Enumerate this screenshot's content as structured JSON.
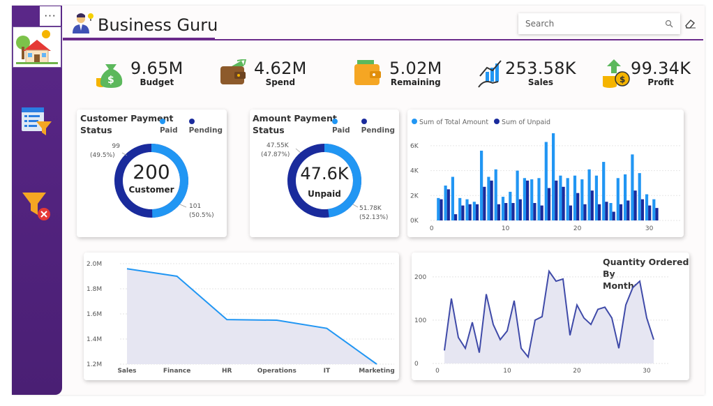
{
  "app": {
    "title": "Business Guru"
  },
  "search": {
    "placeholder": "Search"
  },
  "menu": {
    "dots": "···"
  },
  "kpis": [
    {
      "value": "9.65M",
      "label": "Budget"
    },
    {
      "value": "4.62M",
      "label": "Spend"
    },
    {
      "value": "5.02M",
      "label": "Remaining"
    },
    {
      "value": "253.58K",
      "label": "Sales"
    },
    {
      "value": "99.34K",
      "label": "Profit"
    }
  ],
  "donut_customer": {
    "title_line1": "Customer Payment",
    "title_line2": "Status",
    "legend": [
      "Paid",
      "Pending"
    ],
    "center_value": "200",
    "center_label": "Customer",
    "paid_label_1": "99",
    "paid_label_2": "(49.5%)",
    "pending_label_1": "101",
    "pending_label_2": "(50.5%)",
    "paid_fraction": 0.495
  },
  "donut_amount": {
    "title_line1": "Amount Payment",
    "title_line2": "Status",
    "legend": [
      "Paid",
      "Pending"
    ],
    "center_value": "47.6K",
    "center_label": "Unpaid",
    "paid_label_1": "47.55K",
    "paid_label_2": "(47.87%)",
    "pending_label_1": "51.78K",
    "pending_label_2": "(52.13%)",
    "paid_fraction": 0.4787
  },
  "colors": {
    "paid": "#2196f3",
    "pending": "#1a2b9c",
    "purple": "#5a2788",
    "line": "#2196f3",
    "area": "#e6e6f2",
    "qty": "#3f4aa8"
  },
  "chart_data": [
    {
      "type": "bar",
      "legend": [
        "Sum of Total Amount",
        "Sum of Unpaid"
      ],
      "x": [
        1,
        2,
        3,
        4,
        5,
        6,
        7,
        8,
        9,
        10,
        11,
        12,
        13,
        14,
        15,
        16,
        17,
        18,
        19,
        20,
        21,
        22,
        23,
        24,
        25,
        26,
        27,
        28,
        29,
        30,
        31
      ],
      "series": [
        {
          "name": "Sum of Total Amount",
          "values": [
            1800,
            2800,
            3500,
            1800,
            1700,
            1500,
            5600,
            3500,
            4100,
            1900,
            2300,
            4000,
            3400,
            3300,
            3400,
            6300,
            7000,
            3600,
            3400,
            3600,
            3300,
            4100,
            3600,
            4700,
            1400,
            3400,
            3700,
            5300,
            3800,
            2100,
            1700
          ]
        },
        {
          "name": "Sum of Unpaid",
          "values": [
            1700,
            2500,
            500,
            1200,
            1300,
            1300,
            2700,
            3200,
            1300,
            1400,
            1400,
            1700,
            3200,
            1400,
            1200,
            2600,
            3200,
            2700,
            1200,
            2200,
            1300,
            2400,
            1300,
            1500,
            700,
            1300,
            1600,
            2400,
            1700,
            1200,
            1000
          ]
        }
      ],
      "yticks": [
        "0K",
        "2K",
        "4K",
        "6K"
      ],
      "xticks": [
        "0",
        "10",
        "20",
        "30"
      ],
      "ylim": [
        0,
        7000
      ]
    },
    {
      "type": "area",
      "categories": [
        "Sales",
        "Finance",
        "HR",
        "Operations",
        "IT",
        "Marketing"
      ],
      "values": [
        1960000,
        1900000,
        1555000,
        1550000,
        1485000,
        1200000
      ],
      "yticks": [
        "1.2M",
        "1.4M",
        "1.6M",
        "1.8M",
        "2.0M"
      ],
      "ylim": [
        1200000,
        2000000
      ]
    },
    {
      "type": "area",
      "title_line1": "Quantity Ordered By",
      "title_line2": "Months",
      "x": [
        1,
        2,
        3,
        4,
        5,
        6,
        7,
        8,
        9,
        10,
        11,
        12,
        13,
        14,
        15,
        16,
        17,
        18,
        19,
        20,
        21,
        22,
        23,
        24,
        25,
        26,
        27,
        28,
        29,
        30,
        31
      ],
      "values": [
        30,
        150,
        60,
        35,
        95,
        25,
        160,
        90,
        55,
        75,
        145,
        35,
        15,
        100,
        108,
        213,
        190,
        195,
        65,
        135,
        105,
        90,
        125,
        130,
        105,
        35,
        135,
        175,
        190,
        105,
        55
      ],
      "yticks": [
        "0",
        "100",
        "200"
      ],
      "xticks": [
        "0",
        "10",
        "20",
        "30"
      ],
      "ylim": [
        0,
        240
      ]
    }
  ]
}
